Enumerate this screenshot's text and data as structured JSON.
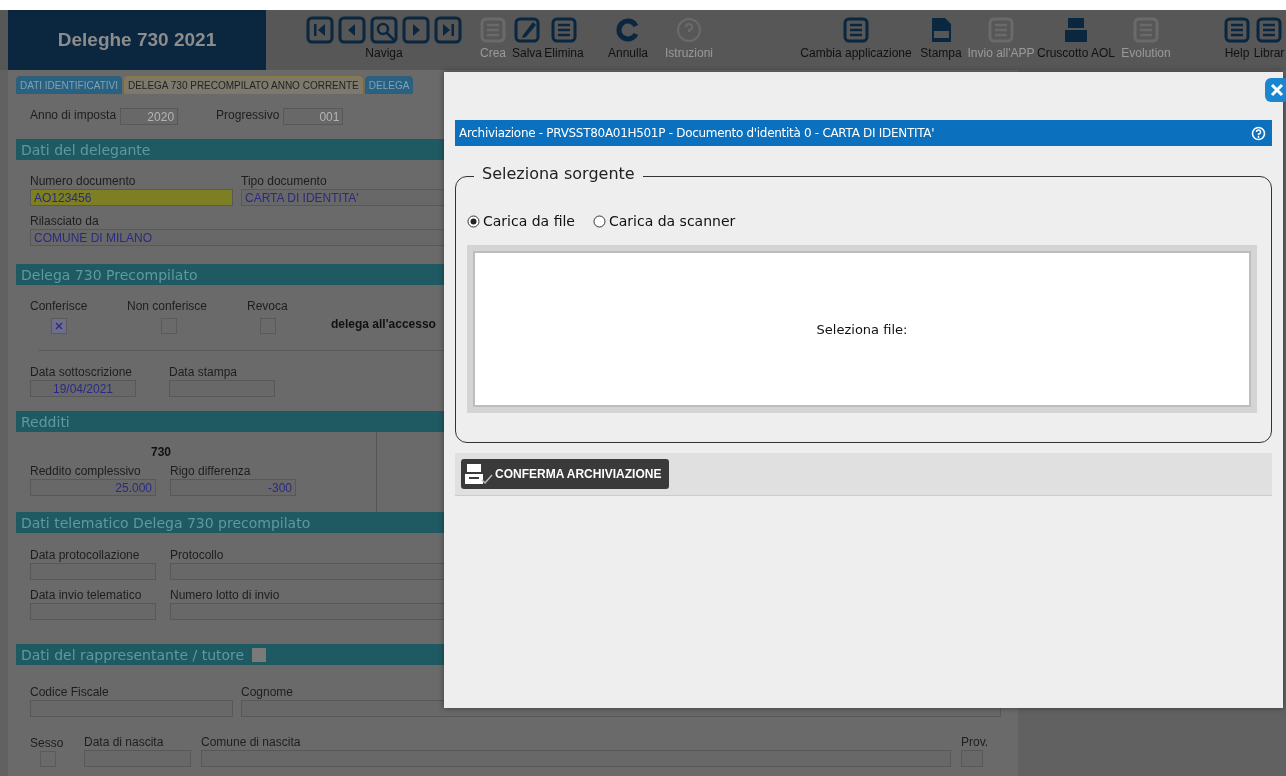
{
  "app": {
    "title": "Deleghe 730 2021"
  },
  "toolbar": {
    "nav_label": "Naviga",
    "items": [
      {
        "label": "Crea",
        "disabled": true
      },
      {
        "label": "Salva",
        "disabled": false
      },
      {
        "label": "Elimina",
        "disabled": false
      },
      {
        "label": "Annulla",
        "disabled": false
      },
      {
        "label": "Istruzioni",
        "disabled": true
      },
      {
        "label": "Cambia applicazione",
        "disabled": false
      },
      {
        "label": "Stampa",
        "disabled": false
      },
      {
        "label": "Invio all'APP",
        "disabled": true
      },
      {
        "label": "Cruscotto AOL",
        "disabled": false
      },
      {
        "label": "Evolution",
        "disabled": true
      },
      {
        "label": "Help",
        "disabled": false
      },
      {
        "label": "Librar",
        "disabled": false
      }
    ]
  },
  "tabs": [
    {
      "label": "DATI IDENTIFICATIVI",
      "selected": false
    },
    {
      "label": "DELEGA 730 PRECOMPILATO ANNO CORRENTE",
      "selected": true
    },
    {
      "label": "DELEGA",
      "selected": false
    }
  ],
  "header": {
    "anno": {
      "label": "Anno di imposta",
      "value": "2020"
    },
    "progressivo": {
      "label": "Progressivo",
      "value": "001"
    }
  },
  "delegante": {
    "title": "Dati del delegante",
    "numero": {
      "label": "Numero documento",
      "value": "AO123456"
    },
    "tipo": {
      "label": "Tipo documento",
      "value": "CARTA DI IDENTITA'"
    },
    "rilasciato": {
      "label": "Rilasciato da",
      "value": "COMUNE DI MILANO"
    }
  },
  "delega": {
    "title": "Delega 730 Precompilato",
    "options": [
      {
        "label": "Conferisce",
        "checked": true
      },
      {
        "label": "Non conferisce",
        "checked": false
      },
      {
        "label": "Revoca",
        "checked": false
      }
    ],
    "note": "delega all'accesso",
    "sottoscrizione": {
      "label": "Data sottoscrizione",
      "value": "19/04/2021"
    },
    "stampa": {
      "label": "Data stampa"
    }
  },
  "redditi": {
    "title": "Redditi",
    "heading": "730",
    "complessivo": {
      "label": "Reddito complessivo",
      "value": "25.000"
    },
    "differenza": {
      "label": "Rigo differenza",
      "value": "-300"
    }
  },
  "telematico": {
    "title": "Dati telematico Delega 730 precompilato",
    "fields": [
      {
        "label": "Data protocollazione"
      },
      {
        "label": "Protocollo"
      },
      {
        "label": "Data invio telematico"
      },
      {
        "label": "Numero lotto di invio"
      }
    ]
  },
  "rappresentante": {
    "title": "Dati del rappresentante / tutore",
    "checked": false,
    "codice": {
      "label": "Codice Fiscale"
    },
    "cognome": {
      "label": "Cognome"
    },
    "sesso": {
      "label": "Sesso"
    },
    "nascita": {
      "label": "Data di nascita"
    },
    "comune": {
      "label": "Comune di nascita"
    },
    "prov": {
      "label": "Prov."
    }
  },
  "dialog": {
    "title": "Archiviazione - PRVSST80A01H501P - Documento d'identità 0 - CARTA DI IDENTITA'",
    "legend": "Seleziona sorgente",
    "sources": [
      {
        "label": "Carica da file",
        "selected": true
      },
      {
        "label": "Carica da scanner",
        "selected": false
      }
    ],
    "drop_label": "Seleziona file:",
    "confirm": "CONFERMA ARCHIVIAZIONE"
  }
}
